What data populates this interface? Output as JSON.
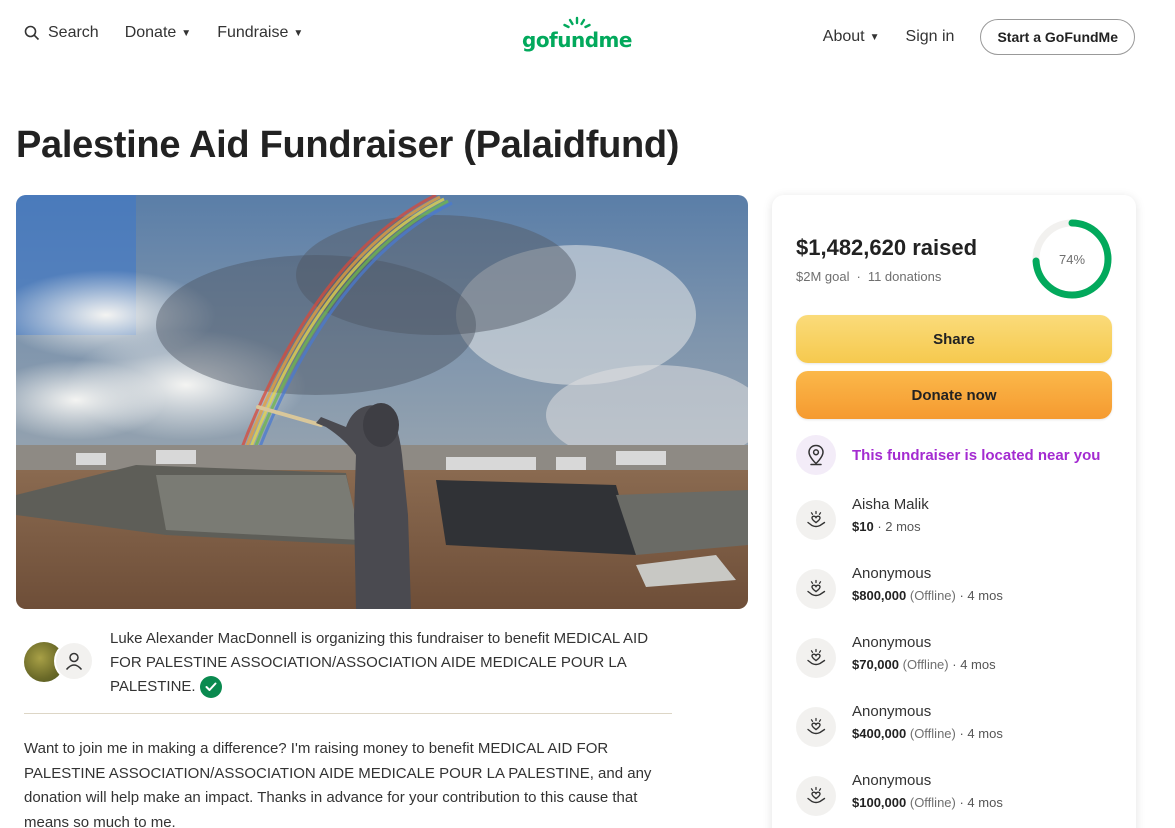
{
  "header": {
    "search_label": "Search",
    "donate_label": "Donate",
    "fundraise_label": "Fundraise",
    "logo_text": "gofundme",
    "about_label": "About",
    "signin_label": "Sign in",
    "start_label": "Start a GoFundMe"
  },
  "page": {
    "title": "Palestine Aid Fundraiser (Palaidfund)"
  },
  "organizer": {
    "text": "Luke Alexander MacDonnell is organizing this fundraiser to benefit MEDICAL AID FOR PALESTINE ASSOCIATION/ASSOCIATION AIDE MEDICALE POUR LA PALESTINE.",
    "verified_icon": "check-circle"
  },
  "story": {
    "text": "Want to join me in making a difference? I'm raising money to benefit MEDICAL AID FOR PALESTINE ASSOCIATION/ASSOCIATION AIDE MEDICALE POUR LA PALESTINE, and any donation will help make an impact. Thanks in advance for your contribution to this cause that means so much to me."
  },
  "progress": {
    "raised": "$1,482,620 raised",
    "goal": "$2M goal",
    "donations": "11 donations",
    "percent_label": "74%",
    "fraction": 0.74
  },
  "actions": {
    "share_label": "Share",
    "donate_label": "Donate now"
  },
  "location": {
    "text": "This fundraiser is located near you"
  },
  "donations": [
    {
      "name": "Aisha Malik",
      "amount": "$10",
      "offline": "",
      "time": "2 mos"
    },
    {
      "name": "Anonymous",
      "amount": "$800,000",
      "offline": "(Offline)",
      "time": "4 mos"
    },
    {
      "name": "Anonymous",
      "amount": "$70,000",
      "offline": "(Offline)",
      "time": "4 mos"
    },
    {
      "name": "Anonymous",
      "amount": "$400,000",
      "offline": "(Offline)",
      "time": "4 mos"
    },
    {
      "name": "Anonymous",
      "amount": "$100,000",
      "offline": "(Offline)",
      "time": "4 mos"
    }
  ],
  "colors": {
    "brand": "#02a95c",
    "accent_purple": "#a42bd1",
    "share_yellow": "#f6c94e",
    "donate_orange": "#f59a30"
  }
}
